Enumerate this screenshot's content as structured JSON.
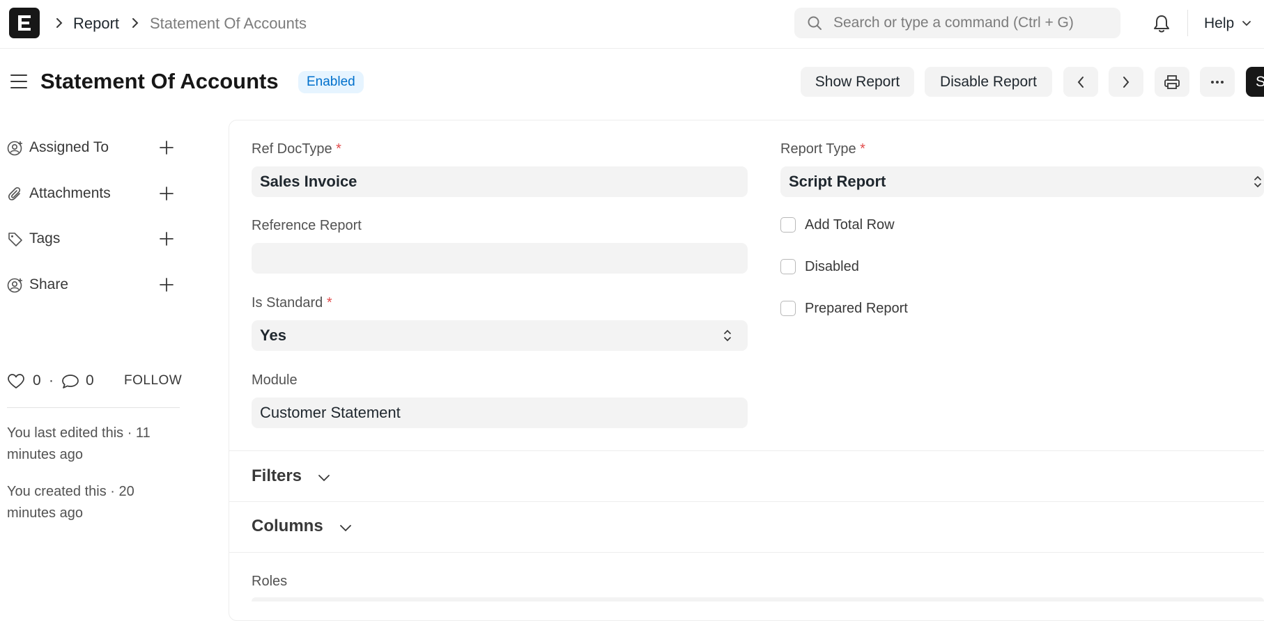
{
  "navbar": {
    "logo_letter": "E",
    "breadcrumbs": [
      "Report",
      "Statement Of Accounts"
    ],
    "search_placeholder": "Search or type a command (Ctrl + G)",
    "help_label": "Help"
  },
  "page_head": {
    "title": "Statement Of Accounts",
    "status_badge": "Enabled",
    "buttons": {
      "show_report": "Show Report",
      "disable_report": "Disable Report",
      "primary_partial": "S"
    }
  },
  "sidebar": {
    "items": [
      {
        "label": "Assigned To",
        "icon": "assign-user-icon"
      },
      {
        "label": "Attachments",
        "icon": "paperclip-icon"
      },
      {
        "label": "Tags",
        "icon": "tag-icon"
      },
      {
        "label": "Share",
        "icon": "share-user-icon"
      }
    ],
    "likes": "0",
    "comments": "0",
    "dot": "·",
    "follow_label": "FOLLOW",
    "timeline": [
      "You last edited this · 11 minutes ago",
      "You created this · 20 minutes ago"
    ]
  },
  "form": {
    "ref_doctype": {
      "label": "Ref DocType",
      "required_mark": "*",
      "value": "Sales Invoice"
    },
    "reference_report": {
      "label": "Reference Report",
      "value": ""
    },
    "is_standard": {
      "label": "Is Standard",
      "required_mark": "*",
      "value": "Yes"
    },
    "module": {
      "label": "Module",
      "value": "Customer Statement"
    },
    "report_type": {
      "label": "Report Type",
      "required_mark": "*",
      "value": "Script Report"
    },
    "checkboxes": [
      {
        "label": "Add Total Row",
        "checked": false
      },
      {
        "label": "Disabled",
        "checked": false
      },
      {
        "label": "Prepared Report",
        "checked": false
      }
    ],
    "sections": {
      "filters": "Filters",
      "columns": "Columns",
      "roles": "Roles"
    }
  },
  "colors": {
    "accent_blue": "#0070cc",
    "badge_bg": "#e6f4ff",
    "required_red": "#e24c4c",
    "primary_dark": "#171717"
  }
}
